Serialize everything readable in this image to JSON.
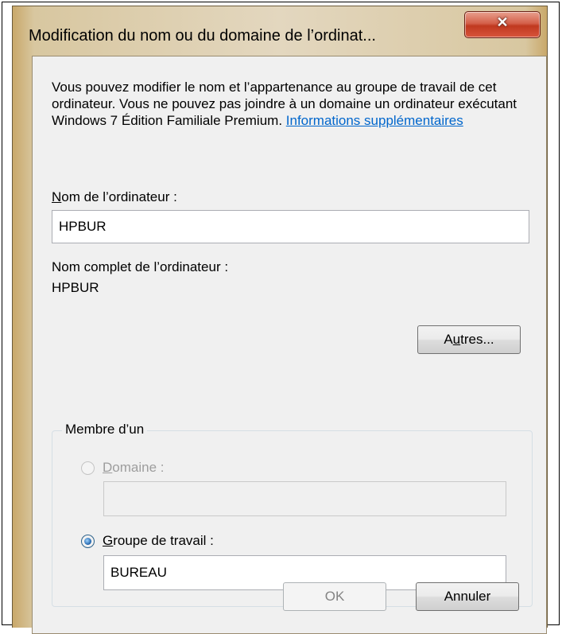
{
  "window": {
    "title": "Modification du nom ou du domaine de l’ordinat...",
    "close_icon": "✕"
  },
  "description": {
    "text": "Vous pouvez modifier le nom et l’appartenance au groupe de travail de cet ordinateur. Vous ne pouvez pas joindre à un domaine un ordinateur exécutant Windows 7 Édition Familiale Premium. ",
    "link": "Informations supplémentaires"
  },
  "computer_name": {
    "label_ul": "N",
    "label_rest": "om de l’ordinateur :",
    "value": "HPBUR"
  },
  "full_name": {
    "label": "Nom complet de l’ordinateur :",
    "value": "HPBUR"
  },
  "more_button": {
    "label_pre": "A",
    "label_ul": "u",
    "label_rest": "tres..."
  },
  "member_of": {
    "legend": "Membre d’un",
    "domain": {
      "label_ul": "D",
      "label_rest": "omaine :",
      "value": "",
      "enabled": false,
      "checked": false
    },
    "workgroup": {
      "label_ul": "G",
      "label_rest": "roupe de travail :",
      "value": "BUREAU",
      "enabled": true,
      "checked": true
    }
  },
  "buttons": {
    "ok": "OK",
    "cancel": "Annuler"
  },
  "colors": {
    "link": "#0066cc",
    "close": "#c0391f",
    "dialog_bg": "#f0f0f0"
  }
}
